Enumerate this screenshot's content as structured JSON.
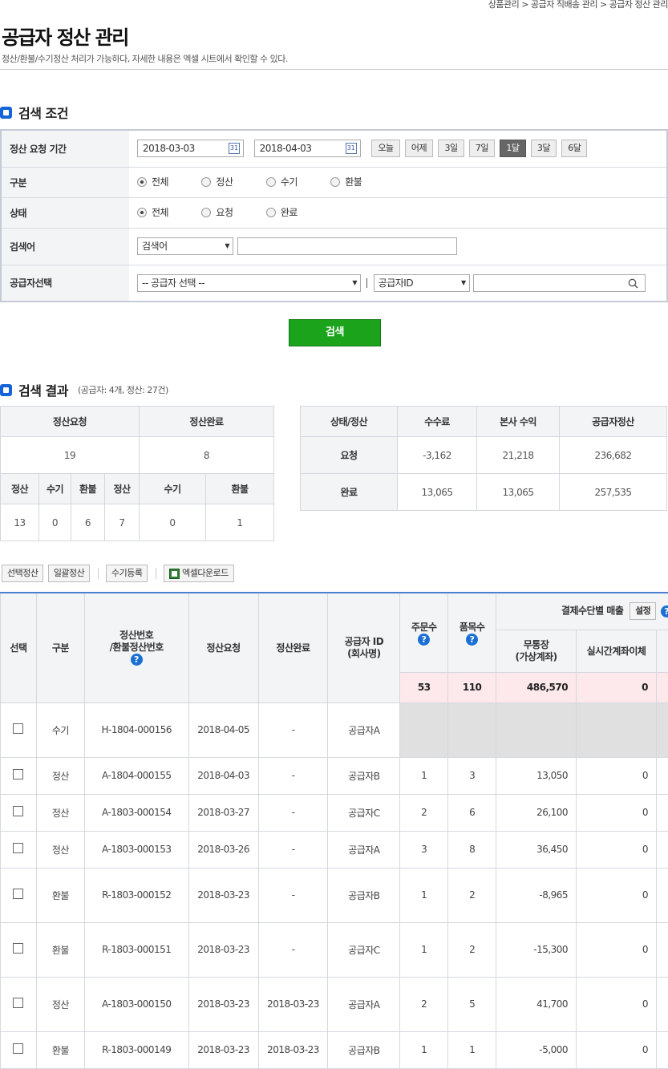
{
  "header": {
    "breadcrumb": "상품관리 > 공급자 직배송 관리 > 공급자 정산 관리",
    "title": "공급자 정산 관리",
    "description": "정산/환불/수기정산 처리가 가능하다, 자세한 내용은 엑셀 시트에서 확인할 수 있다."
  },
  "search_section": {
    "title": "검색 조건",
    "period_label": "정산 요청 기간",
    "date_from": "2018-03-03",
    "date_to": "2018-04-03",
    "calendar_glyph": "31",
    "period_buttons": [
      "오늘",
      "어제",
      "3일",
      "7일",
      "1달",
      "3달",
      "6달"
    ],
    "period_selected": "1달",
    "type_label": "구분",
    "type_options": [
      "전체",
      "정산",
      "수기",
      "환불"
    ],
    "status_label": "상태",
    "status_options": [
      "전체",
      "요청",
      "완료"
    ],
    "keyword_label": "검색어",
    "keyword_select": "검색어",
    "keyword_value": "",
    "supplier_label": "공급자선택",
    "supplier_select": "-- 공급자 선택 --",
    "supplier_id_select": "공급자ID",
    "supplier_search_value": "",
    "search_button": "검색"
  },
  "result_section": {
    "title": "검색 결과",
    "summary": "(공급자: 4개, 정산: 27건)",
    "left_table": {
      "headers": [
        "정산요청",
        "정산완료"
      ],
      "totals": [
        "19",
        "8"
      ],
      "sub_headers": [
        "정산",
        "수기",
        "환불",
        "정산",
        "수기",
        "환불"
      ],
      "sub_values": [
        "13",
        "0",
        "6",
        "7",
        "0",
        "1"
      ]
    },
    "right_table": {
      "headers": [
        "상태/정산",
        "수수료",
        "본사 수익",
        "공급자정산"
      ],
      "rows": [
        [
          "요청",
          "-3,162",
          "21,218",
          "236,682"
        ],
        [
          "완료",
          "13,065",
          "13,065",
          "257,535"
        ]
      ]
    }
  },
  "toolbar": {
    "select_settle": "선택정산",
    "bulk_settle": "일괄정산",
    "manual_register": "수기등록",
    "excel_download": "엑셀다운로드"
  },
  "main_table": {
    "headers": {
      "select": "선택",
      "type": "구분",
      "settle_no": "정산번호\n/환불정산번호",
      "request": "정산요청",
      "complete": "정산완료",
      "supplier": "공급자 ID\n(회사명)",
      "orders": "주문수",
      "items": "품목수",
      "payment_group": "결제수단별 매출",
      "setting_button": "설정",
      "bank": "무통장\n(가상계좌)",
      "realtime": "실시간계좌이체"
    },
    "question_mark": "?",
    "totals": {
      "orders": "53",
      "items": "110",
      "bank": "486,570",
      "realtime": "0"
    },
    "rows": [
      {
        "type": "수기",
        "no": "H-1804-000156",
        "request": "2018-04-05",
        "complete": "-",
        "supplier": "공급자A",
        "orders": "",
        "items": "",
        "bank": "",
        "realtime": ""
      },
      {
        "type": "정산",
        "no": "A-1804-000155",
        "request": "2018-04-03",
        "complete": "-",
        "supplier": "공급자B",
        "orders": "1",
        "items": "3",
        "bank": "13,050",
        "realtime": "0"
      },
      {
        "type": "정산",
        "no": "A-1803-000154",
        "request": "2018-03-27",
        "complete": "-",
        "supplier": "공급자C",
        "orders": "2",
        "items": "6",
        "bank": "26,100",
        "realtime": "0"
      },
      {
        "type": "정산",
        "no": "A-1803-000153",
        "request": "2018-03-26",
        "complete": "-",
        "supplier": "공급자A",
        "orders": "3",
        "items": "8",
        "bank": "36,450",
        "realtime": "0"
      },
      {
        "type": "환불",
        "no": "R-1803-000152",
        "request": "2018-03-23",
        "complete": "-",
        "supplier": "공급자B",
        "orders": "1",
        "items": "2",
        "bank": "-8,965",
        "realtime": "0"
      },
      {
        "type": "환불",
        "no": "R-1803-000151",
        "request": "2018-03-23",
        "complete": "-",
        "supplier": "공급자C",
        "orders": "1",
        "items": "2",
        "bank": "-15,300",
        "realtime": "0"
      },
      {
        "type": "정산",
        "no": "A-1803-000150",
        "request": "2018-03-23",
        "complete": "2018-03-23",
        "supplier": "공급자A",
        "orders": "2",
        "items": "5",
        "bank": "41,700",
        "realtime": "0"
      },
      {
        "type": "환불",
        "no": "R-1803-000149",
        "request": "2018-03-23",
        "complete": "2018-03-23",
        "supplier": "공급자B",
        "orders": "1",
        "items": "1",
        "bank": "-5,000",
        "realtime": "0"
      }
    ]
  }
}
